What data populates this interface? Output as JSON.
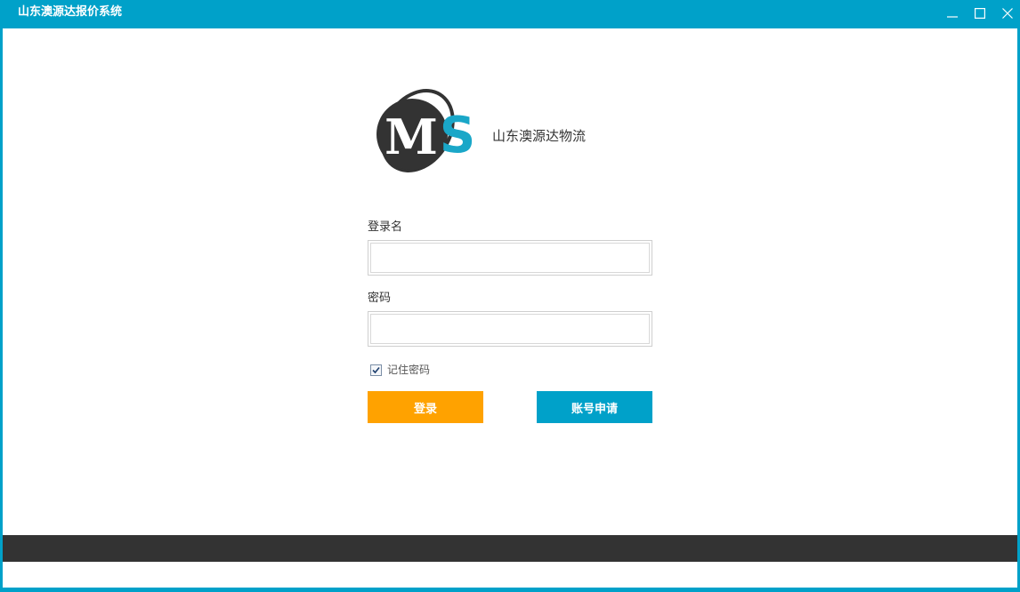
{
  "window": {
    "title": "山东澳源达报价系统"
  },
  "brand": {
    "company_name": "山东澳源达物流",
    "logo_icon": "ms-logo-icon",
    "logo_letters": [
      "M",
      "S"
    ]
  },
  "form": {
    "username_label": "登录名",
    "username_value": "",
    "password_label": "密码",
    "password_value": "",
    "remember_label": "记住密码",
    "remember_checked": true,
    "login_button": "登录",
    "apply_button": "账号申请"
  },
  "colors": {
    "titlebar": "#00a1c9",
    "login_button": "#ffa200",
    "apply_button": "#00a1c9",
    "footer": "#333333",
    "logo_dark": "#333333",
    "logo_accent": "#1aa7c8"
  }
}
